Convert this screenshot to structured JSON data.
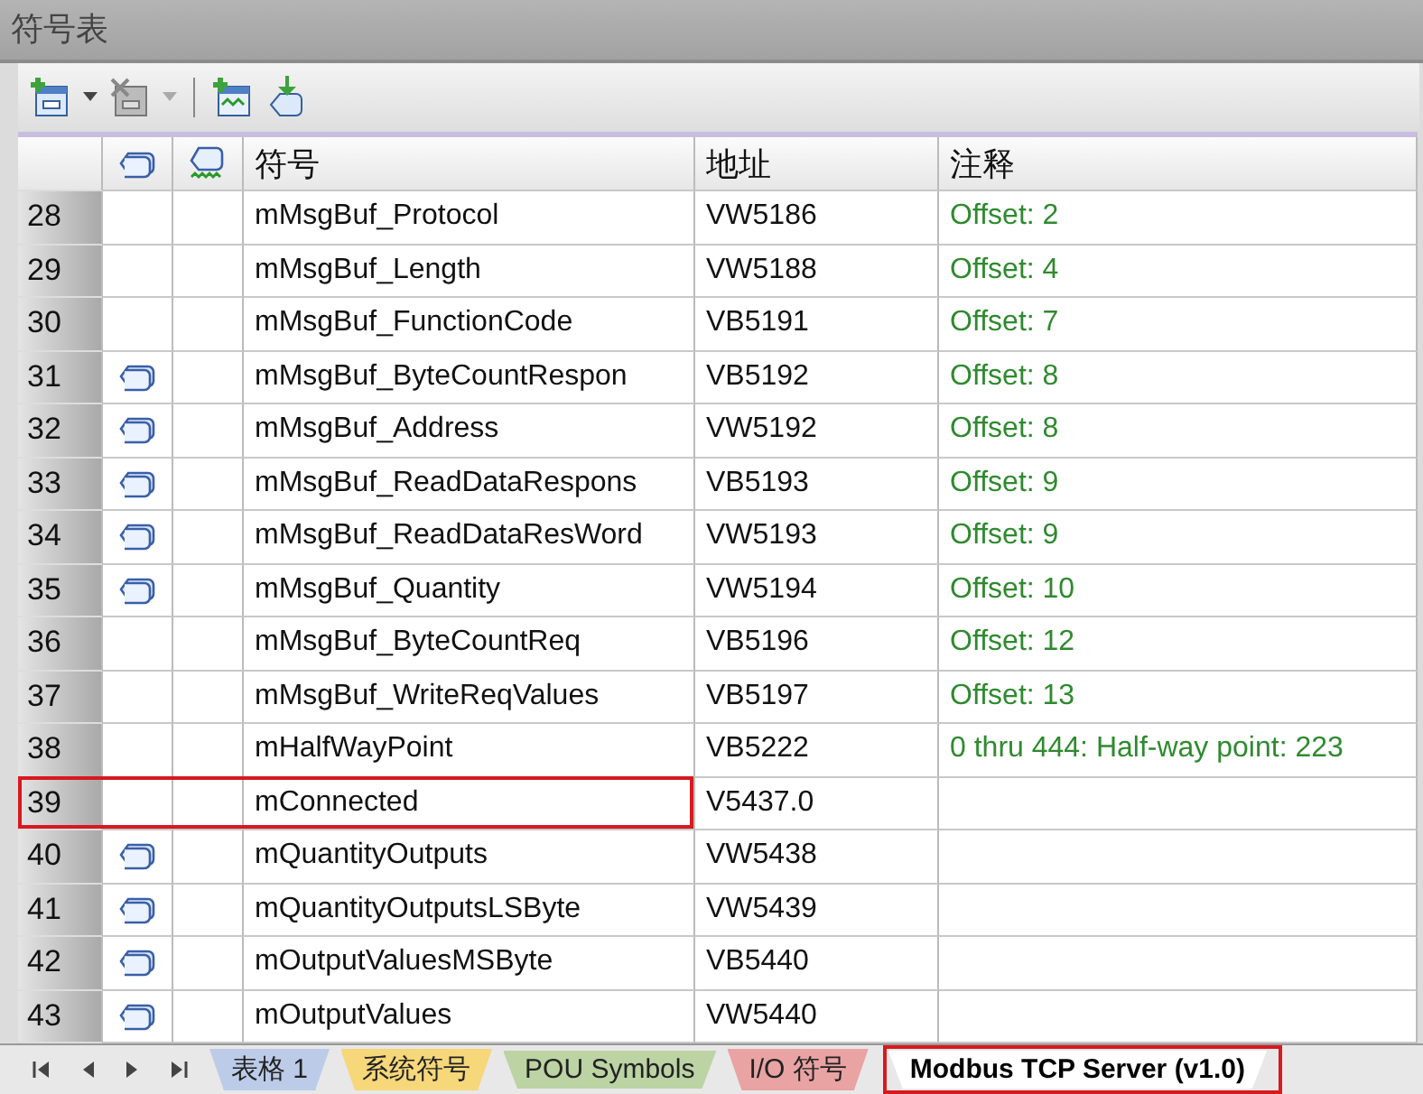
{
  "panel": {
    "title": "符号表"
  },
  "toolbar": {
    "buttons": [
      {
        "kind": "add-tag"
      },
      {
        "kind": "dropdown",
        "disabled": false
      },
      {
        "kind": "delete-tag"
      },
      {
        "kind": "dropdown",
        "disabled": true
      },
      {
        "kind": "separator"
      },
      {
        "kind": "add-chart"
      },
      {
        "kind": "import-tag"
      }
    ]
  },
  "table": {
    "columns": [
      "符号",
      "地址",
      "注释"
    ],
    "rows": [
      {
        "number": "28",
        "tagged": false,
        "symbol": "mMsgBuf_Protocol",
        "address": "VW5186",
        "comment": "Offset: 2",
        "highlighted": false
      },
      {
        "number": "29",
        "tagged": false,
        "symbol": "mMsgBuf_Length",
        "address": "VW5188",
        "comment": "Offset: 4",
        "highlighted": false
      },
      {
        "number": "30",
        "tagged": false,
        "symbol": "mMsgBuf_FunctionCode",
        "address": "VB5191",
        "comment": "Offset: 7",
        "highlighted": false
      },
      {
        "number": "31",
        "tagged": true,
        "symbol": "mMsgBuf_ByteCountRespon",
        "address": "VB5192",
        "comment": "Offset: 8",
        "highlighted": false
      },
      {
        "number": "32",
        "tagged": true,
        "symbol": "mMsgBuf_Address",
        "address": "VW5192",
        "comment": "Offset: 8",
        "highlighted": false
      },
      {
        "number": "33",
        "tagged": true,
        "symbol": "mMsgBuf_ReadDataRespons",
        "address": "VB5193",
        "comment": "Offset: 9",
        "highlighted": false
      },
      {
        "number": "34",
        "tagged": true,
        "symbol": "mMsgBuf_ReadDataResWord",
        "address": "VW5193",
        "comment": "Offset: 9",
        "highlighted": false
      },
      {
        "number": "35",
        "tagged": true,
        "symbol": "mMsgBuf_Quantity",
        "address": "VW5194",
        "comment": "Offset: 10",
        "highlighted": false
      },
      {
        "number": "36",
        "tagged": false,
        "symbol": "mMsgBuf_ByteCountReq",
        "address": "VB5196",
        "comment": "Offset: 12",
        "highlighted": false
      },
      {
        "number": "37",
        "tagged": false,
        "symbol": "mMsgBuf_WriteReqValues",
        "address": "VB5197",
        "comment": "Offset: 13",
        "highlighted": false
      },
      {
        "number": "38",
        "tagged": false,
        "symbol": "mHalfWayPoint",
        "address": "VB5222",
        "comment": "0 thru 444: Half-way point: 223",
        "highlighted": false
      },
      {
        "number": "39",
        "tagged": false,
        "symbol": "mConnected",
        "address": "V5437.0",
        "highlighted": true
      },
      {
        "number": "40",
        "tagged": true,
        "symbol": "mQuantityOutputs",
        "address": "VW5438",
        "highlighted": false
      },
      {
        "number": "41",
        "tagged": true,
        "symbol": "mQuantityOutputsLSByte",
        "address": "VW5439",
        "highlighted": false
      },
      {
        "number": "42",
        "tagged": true,
        "symbol": "mOutputValuesMSByte",
        "address": "VB5440",
        "highlighted": false
      },
      {
        "number": "43",
        "tagged": true,
        "symbol": "mOutputValues",
        "address": "VW5440",
        "highlighted": false
      }
    ]
  },
  "sheet_tabs": [
    {
      "label": "表格 1",
      "color": "#bccbe8",
      "selected": false,
      "highlighted": false
    },
    {
      "label": "系统符号",
      "color": "#f6d77a",
      "selected": false,
      "highlighted": false
    },
    {
      "label": "POU Symbols",
      "color": "#bcd3a4",
      "selected": false,
      "highlighted": false
    },
    {
      "label": "I/O 符号",
      "color": "#e9a3a3",
      "selected": false,
      "highlighted": false
    },
    {
      "label": "Modbus TCP Server (v1.0)",
      "color": "#ffffff",
      "selected": true,
      "highlighted": true
    }
  ]
}
